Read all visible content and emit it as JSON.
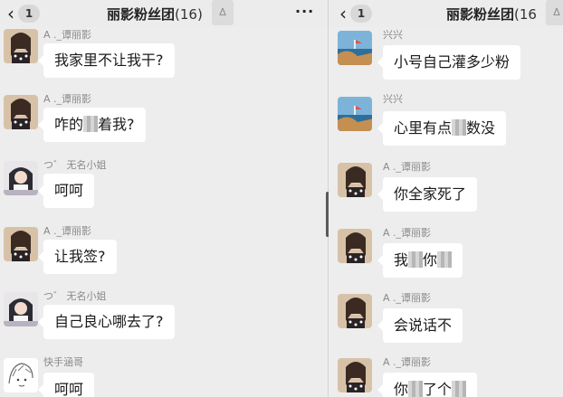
{
  "left": {
    "header": {
      "back_count": "1",
      "title": "丽影粉丝团",
      "count": "(16)",
      "more": "···"
    },
    "messages": [
      {
        "sender": "A ._谭丽影",
        "avatar": "woman-photo-avatar",
        "text": "我家里不让我干?"
      },
      {
        "sender": "A ._谭丽影",
        "avatar": "woman-photo-avatar",
        "text_before": "咋的",
        "text_after": "着我?"
      },
      {
        "sender": "つ゛ 无名小姐",
        "avatar": "girl-photo-avatar",
        "text": "呵呵"
      },
      {
        "sender": "A ._谭丽影",
        "avatar": "woman-photo-avatar",
        "text": "让我签?"
      },
      {
        "sender": "つ゛ 无名小姐",
        "avatar": "girl-photo-avatar",
        "text": "自己良心哪去了?"
      },
      {
        "sender": "快手涵哥",
        "avatar": "sketch-avatar",
        "text": "呵呵"
      }
    ]
  },
  "right": {
    "header": {
      "back_count": "1",
      "title": "丽影粉丝团",
      "count": "(16"
    },
    "messages": [
      {
        "sender": "兴兴",
        "avatar": "seascape-avatar",
        "text": "小号自己灌多少粉"
      },
      {
        "sender": "兴兴",
        "avatar": "seascape-avatar",
        "text_before": "心里有点",
        "text_after": "数没"
      },
      {
        "sender": "A ._谭丽影",
        "avatar": "woman-photo-avatar",
        "text": "你全家死了"
      },
      {
        "sender": "A ._谭丽影",
        "avatar": "woman-photo-avatar",
        "text_before": "我",
        "text_after": "你"
      },
      {
        "sender": "A ._谭丽影",
        "avatar": "woman-photo-avatar",
        "text": "会说话不"
      },
      {
        "sender": "A ._谭丽影",
        "avatar": "woman-photo-avatar",
        "text_before": "你",
        "text_after": "了个"
      }
    ]
  }
}
